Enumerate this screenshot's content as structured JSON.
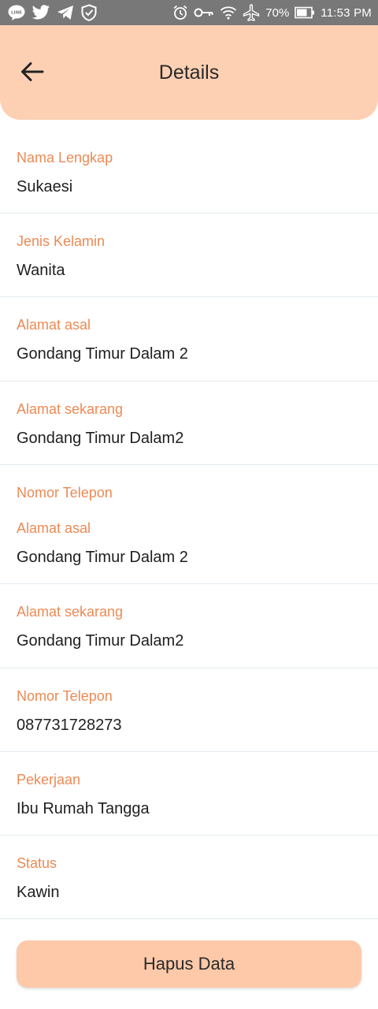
{
  "status_bar": {
    "battery_percent": "70%",
    "time": "11:53 PM",
    "left_icons": [
      "line-icon",
      "twitter-icon",
      "telegram-icon",
      "shield-check-icon"
    ],
    "right_icons": [
      "alarm-icon",
      "vpn-key-icon",
      "wifi-icon",
      "airplane-icon",
      "battery-icon"
    ],
    "line_badge": "LINE"
  },
  "header": {
    "title": "Details",
    "back_icon": "arrow-left-icon",
    "background": "#fdd0b3"
  },
  "fields": [
    {
      "label": "Nama Lengkap",
      "value": "Sukaesi"
    },
    {
      "label": "Jenis Kelamin",
      "value": "Wanita"
    },
    {
      "label": "Alamat asal",
      "value": "Gondang Timur Dalam 2"
    },
    {
      "label": "Alamat sekarang",
      "value": "Gondang Timur Dalam2"
    },
    {
      "label": "Nomor Telepon"
    },
    {
      "label": "Alamat asal",
      "value": "Gondang Timur Dalam 2"
    },
    {
      "label": "Alamat sekarang",
      "value": "Gondang Timur Dalam2"
    },
    {
      "label": "Nomor Telepon",
      "value": "087731728273"
    },
    {
      "label": "Pekerjaan",
      "value": "Ibu Rumah Tangga"
    },
    {
      "label": "Status",
      "value": "Kawin"
    }
  ],
  "actions": {
    "delete_label": "Hapus Data"
  },
  "colors": {
    "label": "#ec8a55",
    "button": "#fdc9a9",
    "status_bar": "#787878"
  }
}
